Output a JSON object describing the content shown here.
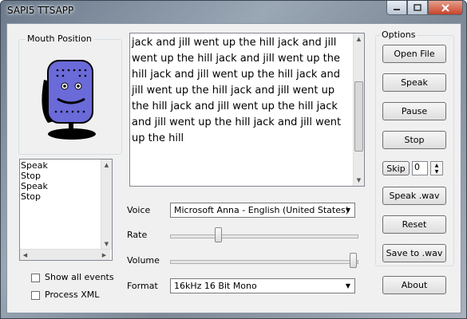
{
  "window": {
    "title": "SAPI5 TTSAPP"
  },
  "mouth_position": {
    "label": "Mouth Position"
  },
  "text_input": {
    "value": "jack and jill went up the hill jack and jill went up the hill jack and jill went up the hill jack and jill went up the hill jack and jill went up the hill jack and jill went up the hill jack and jill went up the hill jack and jill went up the hill jack and jill went up the hill"
  },
  "events": [
    "Speak",
    "Stop",
    "Speak",
    "Stop"
  ],
  "checkboxes": {
    "show_all_events": "Show all events",
    "process_xml": "Process XML"
  },
  "controls": {
    "voice_label": "Voice",
    "voice_value": "Microsoft Anna - English (United States)",
    "rate_label": "Rate",
    "rate_level": 0.25,
    "volume_label": "Volume",
    "volume_level": 1.0,
    "format_label": "Format",
    "format_value": "16kHz 16 Bit Mono"
  },
  "options": {
    "label": "Options",
    "open_file": "Open File",
    "speak": "Speak",
    "pause": "Pause",
    "stop": "Stop",
    "skip": "Skip",
    "skip_value": "0",
    "speak_wav": "Speak .wav",
    "reset": "Reset",
    "save_to_wav": "Save to .wav",
    "about": "About"
  }
}
